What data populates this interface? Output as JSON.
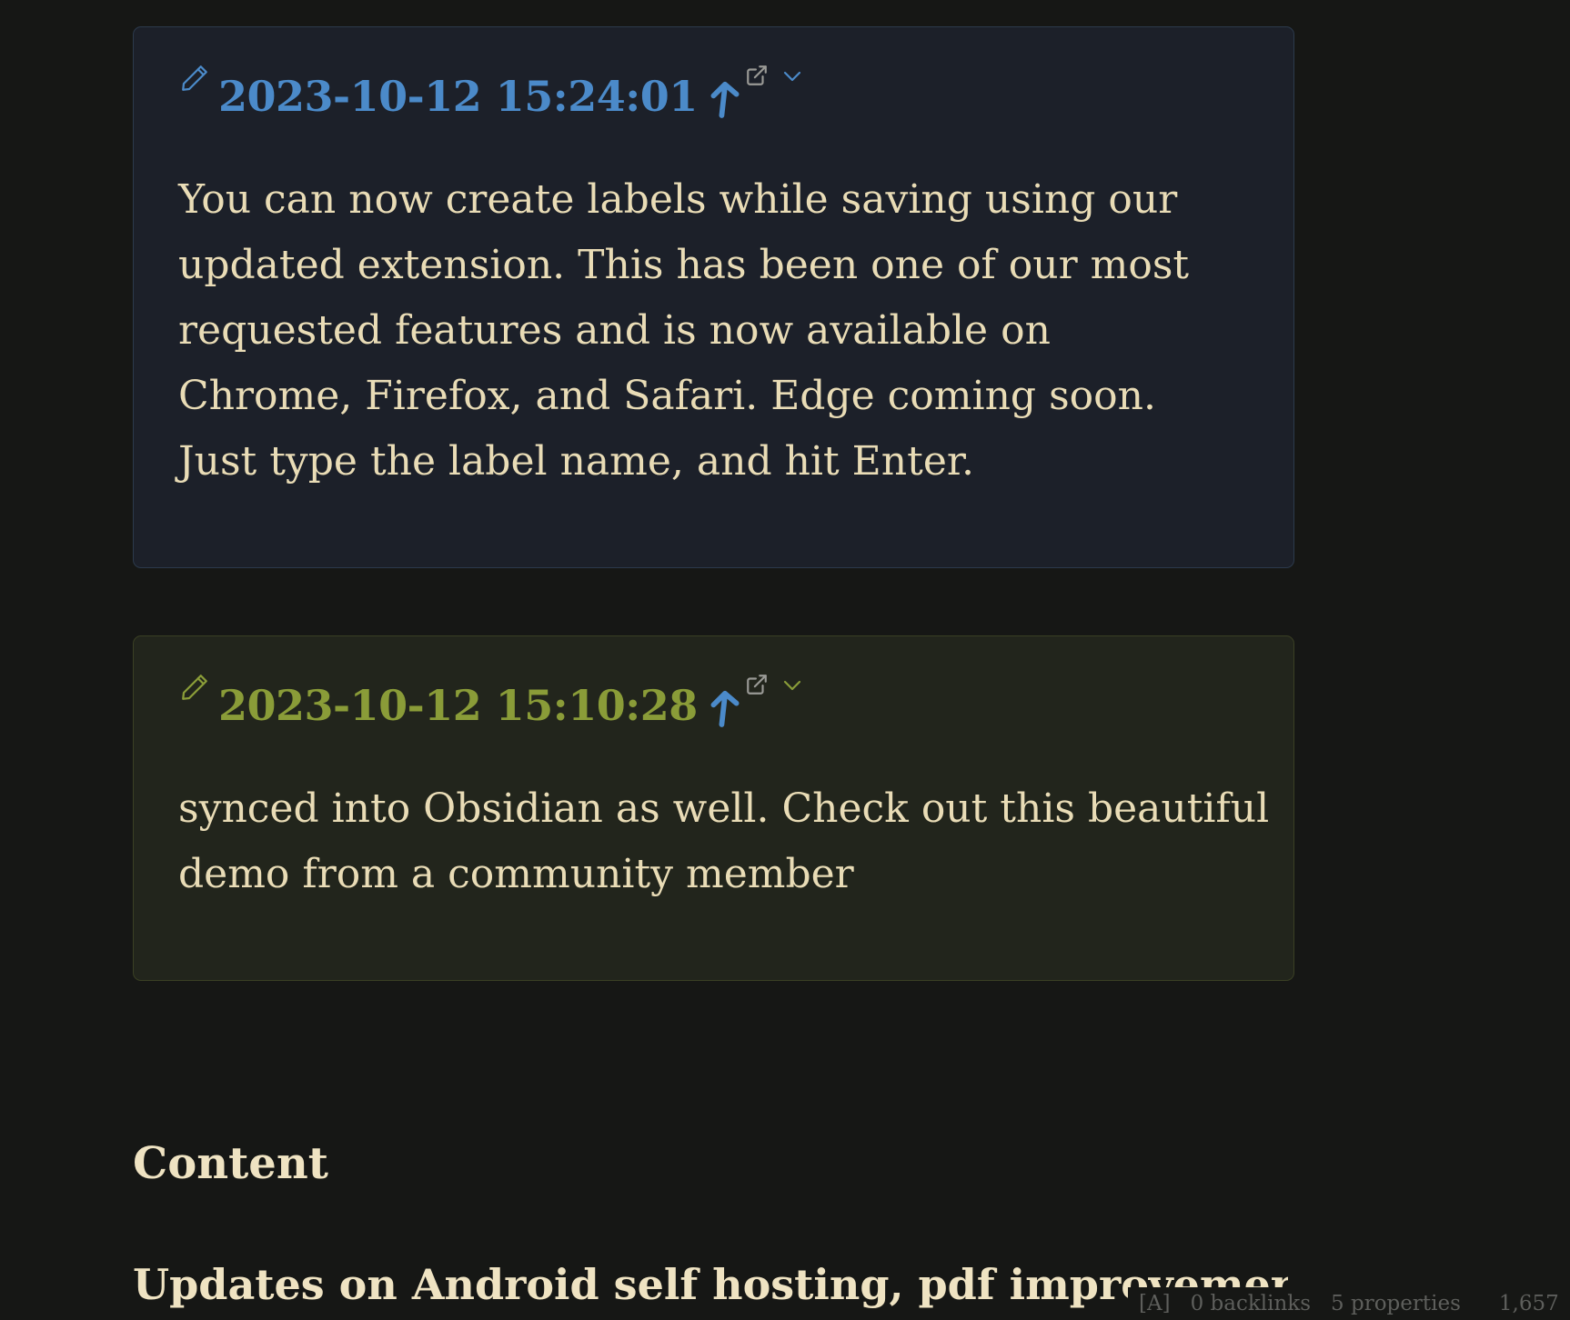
{
  "callouts": [
    {
      "title": "2023-10-12 15:24:01",
      "body": "You can now create labels while saving using our updated extension. This has been one of our most requested features and is now available on Chrome, Firefox, and Safari. Edge coming soon. Just type the label name, and hit Enter.",
      "title_color": "#4b8ac9",
      "icons": [
        "pencil-icon",
        "arrow-up-icon",
        "external-link-icon",
        "chevron-down-icon"
      ]
    },
    {
      "title": "2023-10-12 15:10:28",
      "body": "synced into Obsidian as well. Check out this beautiful demo from a community member",
      "title_color": "#8a9c38",
      "icons": [
        "pencil-icon",
        "arrow-up-icon",
        "external-link-icon",
        "chevron-down-icon"
      ]
    }
  ],
  "headings": {
    "content": "Content",
    "updates": "Updates on Android self hosting, pdf improvemer"
  },
  "status_bar": {
    "mode": "[A]",
    "backlinks": "0 backlinks",
    "properties": "5 properties",
    "word_count": "1,657"
  },
  "colors": {
    "background": "#161715",
    "text": "#e9dcb6",
    "accent_blue": "#4b8ac9",
    "accent_green": "#8a9c38"
  }
}
